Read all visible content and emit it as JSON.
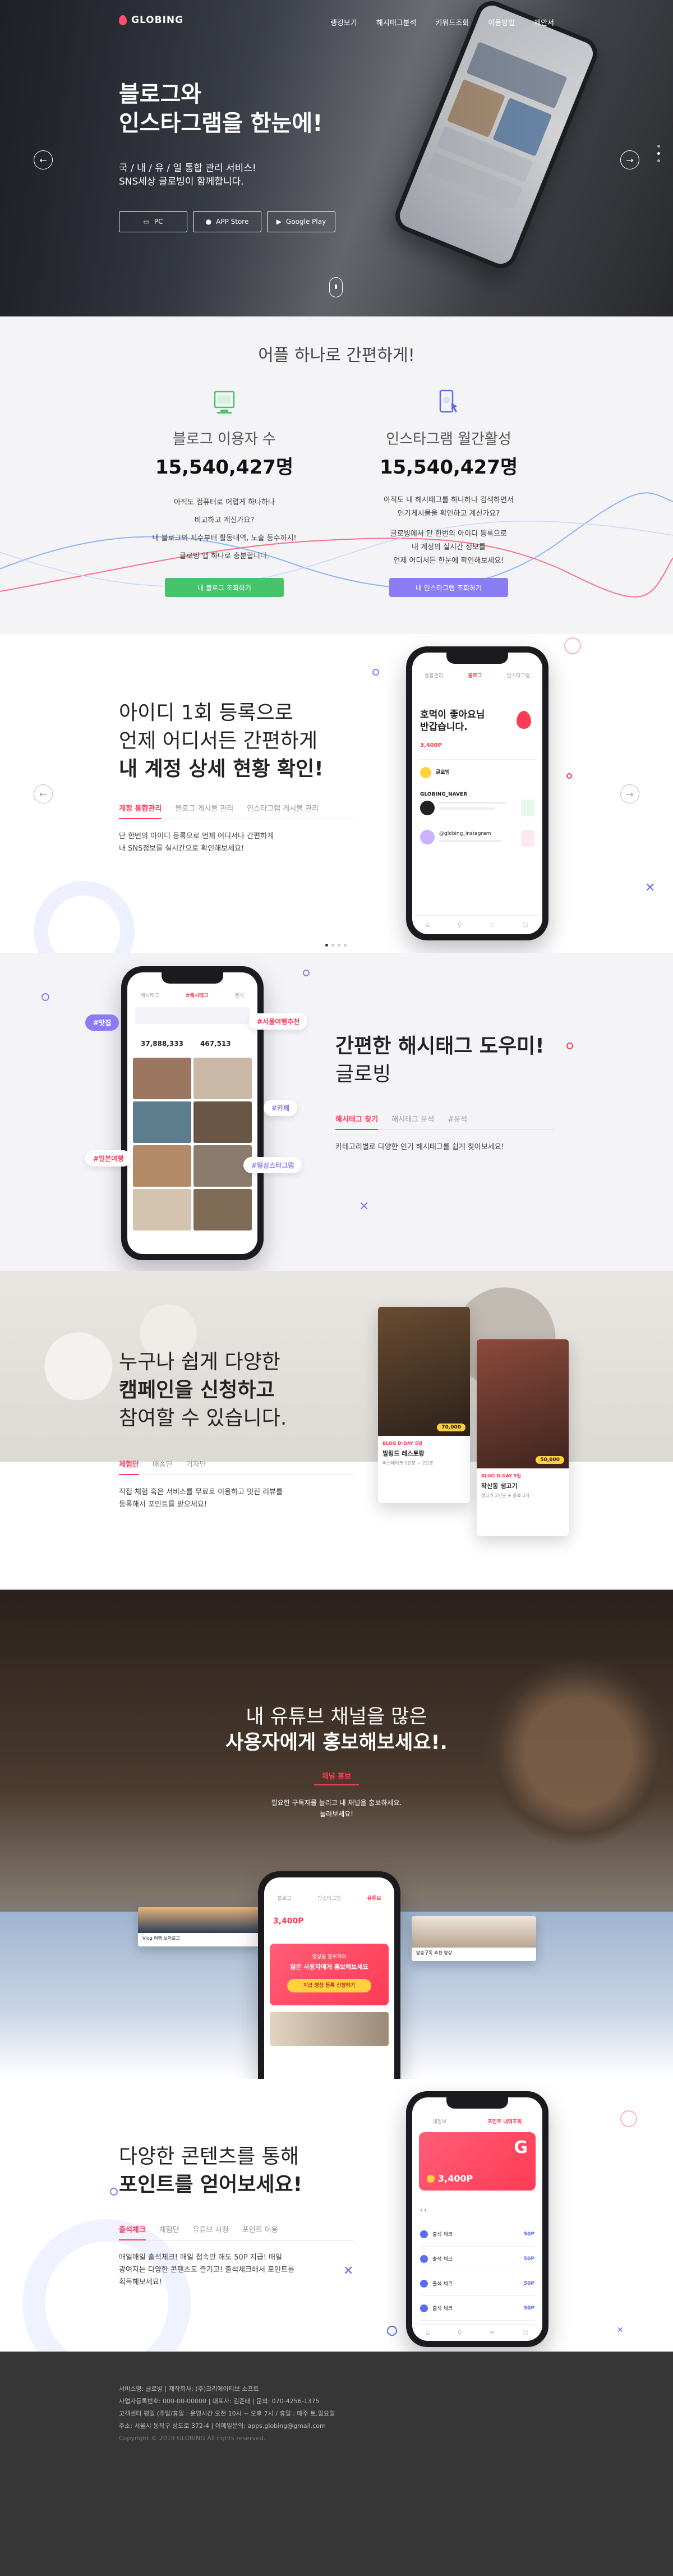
{
  "header": {
    "logo": "GLOBING",
    "nav": [
      "랭킹보기",
      "해시태그분석",
      "키워드조회",
      "이용방법",
      "제안서"
    ]
  },
  "hero": {
    "title_line1": "블로그와",
    "title_line2": "인스타그램을 한눈에!",
    "sub_line1": "국 / 내 / 유 / 일 통합 관리 서비스!",
    "sub_line2": "SNS세상 글로빙이 함께합니다.",
    "store_pc": "PC",
    "store_app": "APP Store",
    "store_google": "Google Play"
  },
  "stats": {
    "title": "어플 하나로 간편하게!",
    "blog": {
      "label": "블로그 이용자 수",
      "value": "15,540,427명",
      "desc": [
        "아직도 컴퓨터로 어렵게 하나하나",
        "비교하고 계신가요?",
        "내 블로그의 지수부터 활동내역, 노출 등수까지!",
        "글로빙 앱 하나로 충분합니다."
      ],
      "button": "내 블로그 조회하기"
    },
    "insta": {
      "label": "인스타그램 월간활성",
      "value": "15,540,427명",
      "desc": [
        "아직도 내 해시태그를 하나하나 검색하면서",
        "인기게시물을 확인하고 계신가요?",
        "글로빙에서 단 한번의 아이디 등록으로",
        "내 계정의 실시간 정보를",
        "언제 어디서든 한눈에 확인해보세요!"
      ],
      "button": "내 인스타그램 조회하기"
    }
  },
  "feature1": {
    "title_line1": "아이디 1회 등록으로",
    "title_line2": "언제 어디서든 간편하게",
    "title_line3": "내 계정 상세 현황 확인!",
    "tabs": [
      "계정 통합관리",
      "블로그 게시물 관리",
      "인스타그램 게시물 관리"
    ],
    "desc_line1": "단 한번의 아이디 등록으로 언제 어디서나 간편하게",
    "desc_line2": "내 SNS정보를 실시간으로 확인해보세요!",
    "phone": {
      "tabs": [
        "통합관리",
        "블로그",
        "인스타그램"
      ],
      "greeting_line1": "호먹이 좋아요님",
      "greeting_line2": "반갑습니다.",
      "points": "3,400P",
      "accounts": [
        "글로빙",
        "GLOBING_NAVER",
        "@globing_instagram"
      ]
    }
  },
  "feature2": {
    "title_line1": "간편한 해시태그 도우미!",
    "title_line2": "글로빙",
    "tabs": [
      "해시태그 찾기",
      "해시태그 분석",
      "#분석"
    ],
    "desc": "카테고리별로 다양한 인기 해시태그를 쉽게 찾아보세요!",
    "bubbles": [
      "#맛집",
      "#서울여행추천",
      "#카페",
      "#일상스타그램",
      "#일본여행"
    ],
    "phone": {
      "counts": [
        "37,888,333",
        "467,513"
      ],
      "tabs": [
        "해시태그",
        "#해시태그",
        "분석"
      ]
    }
  },
  "feature3": {
    "title_line1": "누구나 쉽게 다양한",
    "title_line2": "캠페인을 신청하고",
    "title_line3": "참여할 수 있습니다.",
    "tabs": [
      "체험단",
      "배송단",
      "기자단"
    ],
    "desc_line1": "직접 체험 혹은 서비스를 무료로 이용하고 멋진 리뷰를",
    "desc_line2": "등록해서 포인트를 받으세요!",
    "cards": [
      {
        "badge": "BLOG D-DAY 5일",
        "title": "빌링드 레스토랑",
        "detail": "비스테이크 1인분 + 2인분",
        "price": "70,000"
      },
      {
        "badge": "BLOG D-DAY 5일",
        "title": "작산동 생고기",
        "detail": "생고기 2인분 + 음료 2개",
        "price": "50,000"
      }
    ]
  },
  "feature4": {
    "title_line1": "내 유튜브 채널을 많은",
    "title_line2": "사용자에게 홍보해보세요!.",
    "tab": "채널 홍보",
    "desc_line1": "필요한 구독자를 늘리고 내 채널을 홍보하세요.",
    "desc_line2": "늘려보세요!",
    "phone": {
      "tabs": [
        "블로그",
        "인스타그램",
        "유튜브"
      ],
      "points": "3,400P",
      "promo_line1": "영상을 홍보하여",
      "promo_line2": "많은 사용자에게 홍보해보세요",
      "promo_button": "지금 영상 등록 신청하기"
    },
    "video_left": "Vlog 여행 브이로그",
    "video_right": "방송구독 추천 영상"
  },
  "feature5": {
    "title_line1": "다양한 콘텐츠를 통해",
    "title_line2": "포인트를 얻어보세요!",
    "tabs": [
      "출석체크",
      "체험단",
      "유튜브 시청",
      "포인트 이용"
    ],
    "desc_line1": "매일매일 출석체크! 매일 접속만 해도 50P 지급! 매일",
    "desc_line2": "광여지는 다양한 콘텐츠도 즐기고! 출석체크해서 포인트를",
    "desc_line3": "획득해보세요!",
    "phone": {
      "tabs": [
        "내정보",
        "포인트 내역조회"
      ],
      "points": "3,400P",
      "rows": [
        "출석 체크",
        "출석 체크",
        "출석 체크",
        "출석 체크"
      ],
      "row_points": "50P"
    }
  },
  "footer": {
    "lines": [
      "서비스명: 글로빙  |  제작회사: (주)크리에이티브 소프트",
      "사업자등록번호: 000-00-00000  |  대표자: 김준태  |  문의: 070-4256-1375",
      "고객센터 평일 (주말/휴일 : 운영시간 오전 10시 ~ 오후 7시 / 휴일 : 매주 토,일요일",
      "주소: 서울시 동작구 상도로 372-4  |  이메일문의: apps.globing@gmail.com",
      "Copyright © 2019 GLOBING All rights reserved."
    ]
  },
  "colors": {
    "accent": "#ff3b55",
    "green": "#46c46b",
    "purple": "#8a7cf5",
    "blue": "#5b6cf0"
  }
}
